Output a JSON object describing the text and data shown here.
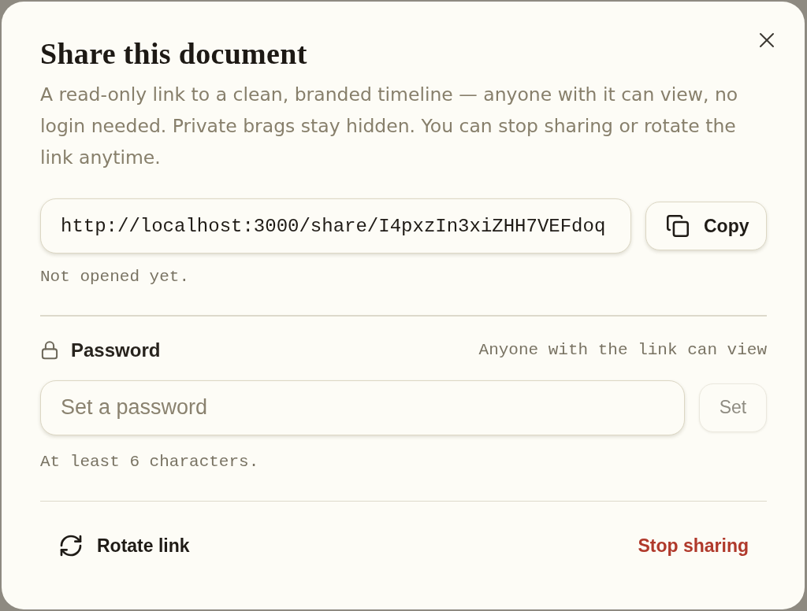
{
  "dialog": {
    "title": "Share this document",
    "description": "A read-only link to a clean, branded timeline — anyone with it can view, no login needed. Private brags stay hidden. You can stop sharing or rotate the link anytime."
  },
  "share_link": {
    "value": "http://localhost:3000/share/I4pxzIn3xiZHH7VEFdoq",
    "copy_button": {
      "label": "Copy"
    },
    "status": "Not opened yet."
  },
  "password": {
    "label": "Password",
    "hint": "Anyone with the link can view",
    "field": {
      "placeholder": "Set a password"
    },
    "set_button": {
      "label": "Set",
      "disabled": true
    },
    "helper": "At least 6 characters."
  },
  "footer": {
    "actions": [
      {
        "kind": "rotate",
        "label": "Rotate link"
      },
      {
        "kind": "danger",
        "label": "Stop sharing"
      }
    ]
  }
}
